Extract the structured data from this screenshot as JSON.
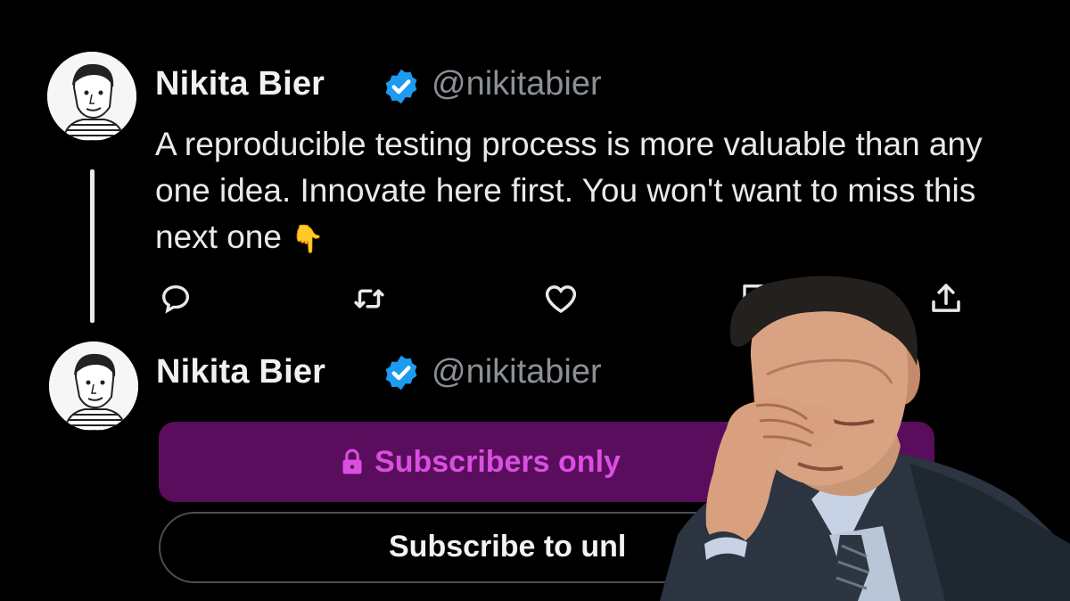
{
  "tweet1": {
    "name": "Nikita Bier",
    "handle": "@nikitabier",
    "text": "A reproducible testing process is more valuable than any one idea. Innovate here first. You won't want to miss this next one",
    "emoji": "👇"
  },
  "tweet1_actions": [
    "reply-icon",
    "retweet-icon",
    "like-icon",
    "bookmark-icon",
    "share-icon"
  ],
  "tweet2": {
    "name": "Nikita Bier",
    "handle": "@nikitabier",
    "subscribers_only_label": "Subscribers only",
    "subscribe_button_label": "Subscribe to unl"
  },
  "colors": {
    "background": "#000000",
    "verified_blue": "#1d9bf0",
    "subscribers_bg": "#5a0d5c",
    "subscribers_text": "#d94fe0",
    "handle_gray": "#8b9097"
  },
  "overlay": "facepalm-photo"
}
